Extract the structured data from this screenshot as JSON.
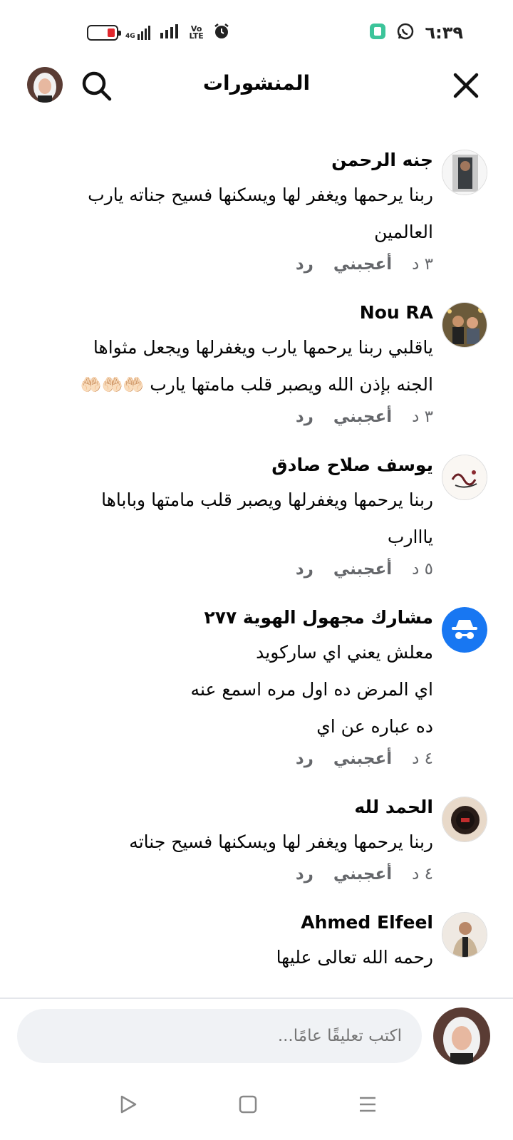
{
  "status_bar": {
    "time": "٦:٣٩",
    "network": "4G",
    "volte": "Vo LTE",
    "battery_level": 0.25
  },
  "header": {
    "title": "المنشورات"
  },
  "comments": [
    {
      "author": "جنه الرحمن",
      "lines": [
        "ربنا يرحمها ويغفر لها ويسكنها فسيح جناته يارب",
        "العالمين"
      ],
      "time_ago": "٣ د",
      "like_label": "أعجبني",
      "reply_label": "رد"
    },
    {
      "author": "Nou RA",
      "lines": [
        "ياقلبي ربنا يرحمها يارب ويغفرلها ويجعل مثواها",
        "الجنه بإذن الله ويصبر قلب مامتها يارب"
      ],
      "emojis": "🤲🏻🤲🏻🤲🏻",
      "time_ago": "٣ د",
      "like_label": "أعجبني",
      "reply_label": "رد"
    },
    {
      "author": "يوسف صلاح صادق",
      "lines": [
        "ربنا يرحمها ويغفرلها ويصبر قلب مامتها وباباها",
        "يااارب"
      ],
      "time_ago": "٥ د",
      "like_label": "أعجبني",
      "reply_label": "رد"
    },
    {
      "author": "مشارك مجهول الهوية ٢٧٧",
      "lines": [
        "معلش يعني اي ساركويد",
        "اي المرض ده اول مره اسمع عنه",
        "ده عباره عن اي"
      ],
      "time_ago": "٤ د",
      "like_label": "أعجبني",
      "reply_label": "رد"
    },
    {
      "author": "الحمد لله",
      "lines": [
        "ربنا يرحمها ويغفر لها ويسكنها فسيح جناته"
      ],
      "time_ago": "٤ د",
      "like_label": "أعجبني",
      "reply_label": "رد"
    },
    {
      "author": "Ahmed Elfeel",
      "lines": [
        "رحمه الله تعالى عليها"
      ],
      "time_ago": "",
      "like_label": "",
      "reply_label": ""
    }
  ],
  "composer": {
    "placeholder": "اكتب تعليقًا عامًا..."
  },
  "icons": {
    "search": "search-icon",
    "close": "close-icon",
    "back": "nav-back-icon",
    "home": "nav-home-icon",
    "recents": "nav-recents-icon"
  },
  "colors": {
    "meta_gray": "#65676b",
    "composer_bg": "#f0f2f5",
    "anonymous_blue": "#1877f2"
  }
}
